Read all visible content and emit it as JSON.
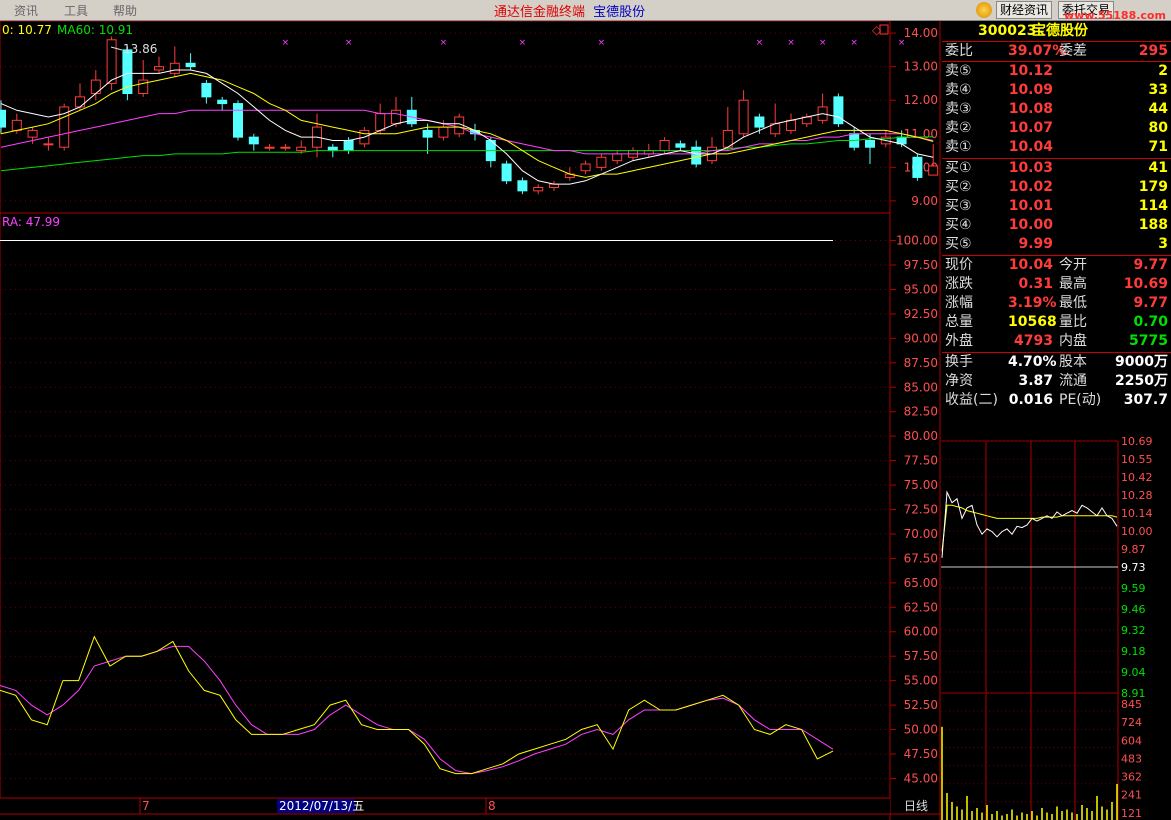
{
  "menu": {
    "items": [
      "资讯",
      "工具",
      "帮助"
    ],
    "app_title": "通达信金融终端",
    "stock_title": "宝德股份",
    "btn_news": "财经资讯",
    "btn_trade": "委托交易",
    "watermark": "www.55188.com"
  },
  "colors": {
    "up": "#ff3b3b",
    "down": "#54ffff",
    "ma_white": "#ffffff",
    "ma_yellow": "#ffff00",
    "ma_magenta": "#ff40ff",
    "ma_green": "#00e000",
    "grid": "#8b0000"
  },
  "kline": {
    "legend_ma_a": "0: 10.77",
    "legend_ma60": "MA60: 10.91",
    "high_label": "13.86",
    "ylim": [
      8.7,
      14.3
    ],
    "yticks": [
      "14.00",
      "13.00",
      "12.00",
      "11.00",
      "10.00",
      "9.00"
    ],
    "candles": [
      [
        11.7,
        11.2,
        12.0,
        11.0
      ],
      [
        11.1,
        11.4,
        11.6,
        11.0
      ],
      [
        10.9,
        11.1,
        11.2,
        10.7
      ],
      [
        10.7,
        10.7,
        10.9,
        10.5
      ],
      [
        10.6,
        11.8,
        11.9,
        10.5
      ],
      [
        11.8,
        12.1,
        12.5,
        11.7
      ],
      [
        12.2,
        12.6,
        12.9,
        12.0
      ],
      [
        12.5,
        13.8,
        13.9,
        12.3
      ],
      [
        13.5,
        12.2,
        13.6,
        12.0
      ],
      [
        12.2,
        12.6,
        13.2,
        12.1
      ],
      [
        12.9,
        13.0,
        13.3,
        12.8
      ],
      [
        12.8,
        13.1,
        13.6,
        12.7
      ],
      [
        13.1,
        13.0,
        13.4,
        12.9
      ],
      [
        12.5,
        12.1,
        12.6,
        11.9
      ],
      [
        12.0,
        11.9,
        12.1,
        11.7
      ],
      [
        11.9,
        10.9,
        12.0,
        10.8
      ],
      [
        10.9,
        10.7,
        11.0,
        10.5
      ],
      [
        10.6,
        10.6,
        10.7,
        10.5
      ],
      [
        10.6,
        10.6,
        10.7,
        10.5
      ],
      [
        10.5,
        10.6,
        10.8,
        10.4
      ],
      [
        10.6,
        11.2,
        11.6,
        10.3
      ],
      [
        10.6,
        10.5,
        10.7,
        10.3
      ],
      [
        10.8,
        10.5,
        10.9,
        10.4
      ],
      [
        10.7,
        11.1,
        11.2,
        10.6
      ],
      [
        11.1,
        11.6,
        11.9,
        11.0
      ],
      [
        11.3,
        11.7,
        12.1,
        11.2
      ],
      [
        11.7,
        11.3,
        12.1,
        11.2
      ],
      [
        11.1,
        10.9,
        11.3,
        10.4
      ],
      [
        10.9,
        11.2,
        11.4,
        10.8
      ],
      [
        11.0,
        11.5,
        11.6,
        10.9
      ],
      [
        11.1,
        11.0,
        11.3,
        10.8
      ],
      [
        10.8,
        10.2,
        10.9,
        10.0
      ],
      [
        10.1,
        9.6,
        10.2,
        9.5
      ],
      [
        9.6,
        9.3,
        9.7,
        9.2
      ],
      [
        9.3,
        9.4,
        9.5,
        9.2
      ],
      [
        9.4,
        9.5,
        9.6,
        9.3
      ],
      [
        9.7,
        9.8,
        10.0,
        9.6
      ],
      [
        9.9,
        10.1,
        10.2,
        9.8
      ],
      [
        10.0,
        10.3,
        10.4,
        9.9
      ],
      [
        10.2,
        10.4,
        10.5,
        10.1
      ],
      [
        10.3,
        10.5,
        10.6,
        10.2
      ],
      [
        10.4,
        10.5,
        10.7,
        10.3
      ],
      [
        10.5,
        10.8,
        10.9,
        10.4
      ],
      [
        10.7,
        10.6,
        10.8,
        10.5
      ],
      [
        10.6,
        10.1,
        10.8,
        10.0
      ],
      [
        10.2,
        10.6,
        10.9,
        10.1
      ],
      [
        10.6,
        11.1,
        11.8,
        10.5
      ],
      [
        11.0,
        12.0,
        12.3,
        10.9
      ],
      [
        11.5,
        11.2,
        11.6,
        11.0
      ],
      [
        11.0,
        11.3,
        11.9,
        10.9
      ],
      [
        11.1,
        11.4,
        11.6,
        11.0
      ],
      [
        11.3,
        11.5,
        11.6,
        11.2
      ],
      [
        11.4,
        11.8,
        12.2,
        11.3
      ],
      [
        12.1,
        11.3,
        12.2,
        11.2
      ],
      [
        11.0,
        10.6,
        11.2,
        10.5
      ],
      [
        10.8,
        10.6,
        11.0,
        10.1
      ],
      [
        10.7,
        10.9,
        11.1,
        10.6
      ],
      [
        10.9,
        10.7,
        11.1,
        10.6
      ],
      [
        10.3,
        9.7,
        10.4,
        9.6
      ],
      [
        9.77,
        10.04,
        10.69,
        9.77
      ]
    ],
    "ma_white": [
      11.9,
      11.7,
      11.6,
      11.5,
      11.6,
      11.8,
      12.2,
      12.6,
      12.8,
      12.8,
      12.8,
      12.9,
      12.9,
      12.8,
      12.5,
      12.2,
      11.8,
      11.4,
      11.1,
      10.9,
      10.9,
      10.8,
      10.8,
      10.9,
      11.1,
      11.3,
      11.4,
      11.4,
      11.3,
      11.3,
      11.1,
      10.8,
      10.4,
      9.9,
      9.6,
      9.5,
      9.5,
      9.6,
      9.8,
      10.0,
      10.2,
      10.3,
      10.4,
      10.5,
      10.4,
      10.4,
      10.6,
      10.9,
      11.1,
      11.3,
      11.4,
      11.5,
      11.6,
      11.5,
      11.2,
      10.9,
      10.8,
      10.7,
      10.4,
      10.3
    ],
    "ma_yellow": [
      11.0,
      11.1,
      11.2,
      11.3,
      11.5,
      11.7,
      11.9,
      12.2,
      12.4,
      12.5,
      12.6,
      12.7,
      12.8,
      12.7,
      12.6,
      12.4,
      12.2,
      11.9,
      11.7,
      11.4,
      11.3,
      11.2,
      11.1,
      11.0,
      11.0,
      11.0,
      11.1,
      11.2,
      11.2,
      11.2,
      11.1,
      11.0,
      10.8,
      10.5,
      10.2,
      10.0,
      9.8,
      9.7,
      9.8,
      9.8,
      9.9,
      10.0,
      10.1,
      10.2,
      10.3,
      10.4,
      10.4,
      10.5,
      10.6,
      10.7,
      10.8,
      10.9,
      11.0,
      11.1,
      11.1,
      11.1,
      11.1,
      11.0,
      10.9,
      10.77
    ],
    "ma_magenta": [
      10.6,
      10.7,
      10.8,
      10.9,
      11.0,
      11.1,
      11.2,
      11.3,
      11.4,
      11.5,
      11.6,
      11.6,
      11.7,
      11.7,
      11.7,
      11.7,
      11.7,
      11.7,
      11.7,
      11.7,
      11.7,
      11.7,
      11.7,
      11.7,
      11.6,
      11.6,
      11.5,
      11.4,
      11.3,
      11.2,
      11.0,
      10.9,
      10.8,
      10.7,
      10.6,
      10.5,
      10.5,
      10.4,
      10.4,
      10.4,
      10.4,
      10.4,
      10.4,
      10.4,
      10.4,
      10.5,
      10.5,
      10.6,
      10.7,
      10.7,
      10.8,
      10.8,
      10.9,
      10.9,
      11.0,
      11.0,
      11.0,
      11.0,
      10.9,
      10.8
    ],
    "ma_green": [
      9.9,
      9.95,
      10.0,
      10.05,
      10.1,
      10.15,
      10.2,
      10.25,
      10.3,
      10.35,
      10.35,
      10.4,
      10.4,
      10.4,
      10.4,
      10.45,
      10.45,
      10.45,
      10.45,
      10.45,
      10.5,
      10.5,
      10.5,
      10.5,
      10.5,
      10.5,
      10.5,
      10.5,
      10.5,
      10.5,
      10.5,
      10.5,
      10.5,
      10.5,
      10.5,
      10.5,
      10.5,
      10.5,
      10.5,
      10.5,
      10.5,
      10.5,
      10.5,
      10.5,
      10.5,
      10.5,
      10.55,
      10.6,
      10.6,
      10.65,
      10.7,
      10.7,
      10.75,
      10.8,
      10.8,
      10.85,
      10.85,
      10.9,
      10.9,
      10.91
    ],
    "marker_idx": [
      18,
      22,
      28,
      33,
      38,
      48,
      50,
      52,
      54,
      57
    ]
  },
  "indicator": {
    "legend": "RA: 47.99",
    "ylim": [
      43.0,
      102.0
    ],
    "yticks": [
      "100.00",
      "97.50",
      "95.00",
      "92.50",
      "90.00",
      "87.50",
      "85.00",
      "82.50",
      "80.00",
      "77.50",
      "75.00",
      "72.50",
      "70.00",
      "67.50",
      "65.00",
      "62.50",
      "60.00",
      "57.50",
      "55.00",
      "52.50",
      "50.00",
      "47.50",
      "45.00"
    ],
    "flat_line": 100.0,
    "yellow": [
      54.0,
      53.5,
      51.0,
      50.5,
      55.0,
      55.0,
      59.5,
      56.5,
      57.5,
      57.5,
      58.0,
      59.0,
      56.0,
      54.0,
      53.5,
      51.0,
      49.5,
      49.5,
      49.5,
      50.0,
      50.5,
      52.5,
      53.0,
      50.5,
      50.0,
      50.0,
      50.0,
      48.5,
      46.0,
      45.5,
      45.5,
      46.0,
      46.5,
      47.5,
      48.0,
      48.5,
      49.0,
      50.0,
      50.5,
      48.0,
      52.0,
      53.0,
      52.0,
      52.0,
      52.5,
      53.0,
      53.5,
      52.5,
      50.0,
      49.5,
      50.5,
      50.0,
      47.0,
      47.8
    ],
    "magenta": [
      54.5,
      54.0,
      52.5,
      51.5,
      52.5,
      54.0,
      56.5,
      57.0,
      57.5,
      57.5,
      58.0,
      58.5,
      58.5,
      57.0,
      55.0,
      52.5,
      50.5,
      49.5,
      49.5,
      49.5,
      50.0,
      51.5,
      52.5,
      51.5,
      50.5,
      50.0,
      50.0,
      49.0,
      47.0,
      45.8,
      45.5,
      45.8,
      46.2,
      46.8,
      47.5,
      48.0,
      48.5,
      49.5,
      50.0,
      49.5,
      51.0,
      52.0,
      52.0,
      52.0,
      52.5,
      53.0,
      53.2,
      52.5,
      51.0,
      50.0,
      50.0,
      50.0,
      49.0,
      47.99
    ]
  },
  "time_axis": {
    "label_a": "7",
    "label_b": "2012/07/13/五",
    "label_c": "8",
    "period_label": "日线"
  },
  "quote": {
    "code": "300023",
    "name": "宝德股份",
    "wb_label": "委比",
    "wb_value": "39.07%",
    "wc_label": "委差",
    "wc_value": "295",
    "sell": [
      {
        "label": "卖⑤",
        "price": "10.12",
        "vol": "2"
      },
      {
        "label": "卖④",
        "price": "10.09",
        "vol": "33"
      },
      {
        "label": "卖③",
        "price": "10.08",
        "vol": "44"
      },
      {
        "label": "卖②",
        "price": "10.07",
        "vol": "80"
      },
      {
        "label": "卖①",
        "price": "10.04",
        "vol": "71"
      }
    ],
    "buy": [
      {
        "label": "买①",
        "price": "10.03",
        "vol": "41"
      },
      {
        "label": "买②",
        "price": "10.02",
        "vol": "179"
      },
      {
        "label": "买③",
        "price": "10.01",
        "vol": "114"
      },
      {
        "label": "买④",
        "price": "10.00",
        "vol": "188"
      },
      {
        "label": "买⑤",
        "price": "9.99",
        "vol": "3"
      }
    ],
    "stats": [
      {
        "l1": "现价",
        "v1": "10.04",
        "c1": "red",
        "l2": "今开",
        "v2": "9.77",
        "c2": "red"
      },
      {
        "l1": "涨跌",
        "v1": "0.31",
        "c1": "red",
        "l2": "最高",
        "v2": "10.69",
        "c2": "red"
      },
      {
        "l1": "涨幅",
        "v1": "3.19%",
        "c1": "red",
        "l2": "最低",
        "v2": "9.77",
        "c2": "red"
      },
      {
        "l1": "总量",
        "v1": "10568",
        "c1": "yel",
        "l2": "量比",
        "v2": "0.70",
        "c2": "grn"
      },
      {
        "l1": "外盘",
        "v1": "4793",
        "c1": "red",
        "l2": "内盘",
        "v2": "5775",
        "c2": "grn"
      }
    ],
    "fund": [
      {
        "l1": "换手",
        "v1": "4.70%",
        "l2": "股本",
        "v2": "9000万"
      },
      {
        "l1": "净资",
        "v1": "3.87",
        "l2": "流通",
        "v2": "2250万"
      },
      {
        "l1": "收益(二)",
        "v1": "0.016",
        "l2": "PE(动)",
        "v2": "307.7"
      }
    ]
  },
  "intraday": {
    "prev_close": 9.73,
    "yticks_up": [
      "10.69",
      "10.55",
      "10.42",
      "10.28",
      "10.14",
      "10.00",
      "9.87"
    ],
    "prev_label": "9.73",
    "yticks_down": [
      "9.59",
      "9.46",
      "9.32",
      "9.18",
      "9.04",
      "8.91"
    ],
    "vol_ticks": [
      "845",
      "724",
      "604",
      "483",
      "362",
      "241",
      "121"
    ],
    "price": [
      9.8,
      10.3,
      10.22,
      10.25,
      10.1,
      10.18,
      10.2,
      10.05,
      9.98,
      10.02,
      10.0,
      9.96,
      10.0,
      10.02,
      9.98,
      10.04,
      10.03,
      10.05,
      10.1,
      10.08,
      10.1,
      10.12,
      10.1,
      10.15,
      10.12,
      10.14,
      10.16,
      10.14,
      10.2,
      10.18,
      10.15,
      10.12,
      10.18,
      10.12,
      10.1,
      10.04
    ],
    "avg": [
      9.85,
      10.2,
      10.2,
      10.19,
      10.18,
      10.16,
      10.15,
      10.14,
      10.13,
      10.12,
      10.11,
      10.1,
      10.1,
      10.1,
      10.1,
      10.1,
      10.1,
      10.1,
      10.1,
      10.1,
      10.11,
      10.11,
      10.11,
      10.11,
      10.12,
      10.12,
      10.12,
      10.12,
      10.12,
      10.12,
      10.12,
      10.12,
      10.12,
      10.12,
      10.12,
      10.11
    ],
    "volume": [
      620,
      180,
      120,
      90,
      70,
      160,
      60,
      80,
      50,
      100,
      40,
      60,
      30,
      40,
      70,
      30,
      50,
      40,
      60,
      30,
      80,
      50,
      40,
      90,
      60,
      70,
      50,
      40,
      100,
      80,
      60,
      160,
      90,
      70,
      120,
      240
    ]
  }
}
